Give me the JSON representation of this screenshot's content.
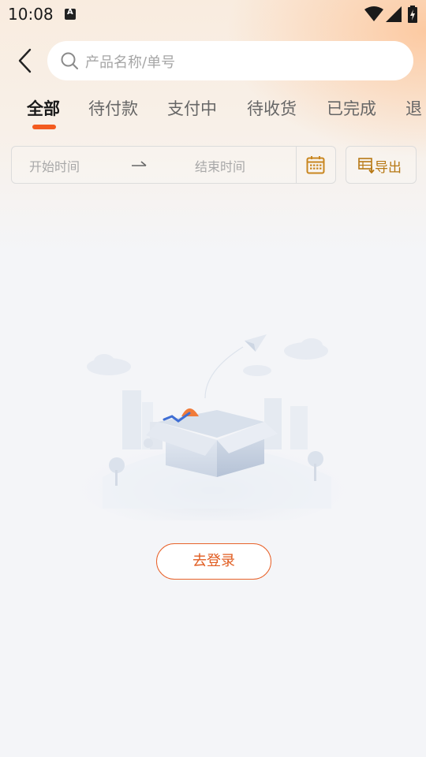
{
  "status_bar": {
    "time": "10:08"
  },
  "search": {
    "placeholder": "产品名称/单号"
  },
  "tabs": [
    {
      "label": "全部",
      "active": true
    },
    {
      "label": "待付款",
      "active": false
    },
    {
      "label": "支付中",
      "active": false
    },
    {
      "label": "待收货",
      "active": false
    },
    {
      "label": "已完成",
      "active": false
    },
    {
      "label": "退",
      "active": false
    }
  ],
  "date_filter": {
    "start_placeholder": "开始时间",
    "end_placeholder": "结束时间"
  },
  "export": {
    "label": "导出"
  },
  "empty_state": {
    "login_label": "去登录"
  },
  "colors": {
    "accent": "#f35b1f",
    "export_text": "#b77814",
    "login_text": "#e05c20"
  }
}
